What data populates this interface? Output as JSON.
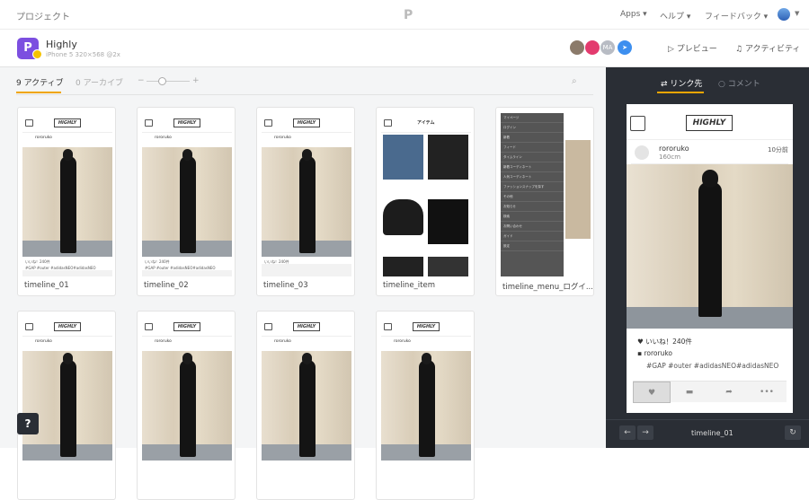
{
  "topbar": {
    "crumb": "プロジェクト",
    "logo": "P",
    "menus": [
      "Apps ▾",
      "ヘルプ ▾",
      "フィードバック ▾"
    ]
  },
  "project": {
    "icon_letter": "P",
    "name": "Highly",
    "device": "iPhone 5  320×568 @2x",
    "avatar_text": "MA",
    "preview_label": "プレビュー",
    "activity_label": "アクティビティ"
  },
  "tabs": {
    "active_label": "9 アクティブ",
    "archive_label": "0 アーカイブ",
    "zoom_minus": "−",
    "zoom_plus": "+",
    "zoom_level": 0.35
  },
  "screens": [
    {
      "label": "timeline_01"
    },
    {
      "label": "timeline_02"
    },
    {
      "label": "timeline_03"
    },
    {
      "label": "timeline_item"
    },
    {
      "label": "timeline_menu_ログイ..."
    },
    {
      "label": ""
    },
    {
      "label": ""
    },
    {
      "label": ""
    },
    {
      "label": ""
    }
  ],
  "mini": {
    "logo": "HIGHLY",
    "user": "rororuko",
    "height": "160cm",
    "time": "10分前",
    "likes": "いいね！240件",
    "tags": "#GAP #outer #adidasNEO#adidasNEO",
    "item_title": "アイテム",
    "menu_items": [
      "マイページ",
      "ログイン",
      "新着",
      "フィード",
      "タイムライン",
      "新着コーディネート",
      "人気コーディネート",
      "ファッションスナップを探す",
      "その他",
      "お知らせ",
      "検索",
      "お問い合わせ",
      "ガイド",
      "設定"
    ]
  },
  "right": {
    "tab_link": "リンク先",
    "tab_comment": "コメント",
    "phone": {
      "logo": "HIGHLY",
      "user": "rororuko",
      "height": "160cm",
      "time": "10分前",
      "likes": "いいね！240件",
      "owner": "rororuko",
      "tags": "#GAP #outer #adidasNEO#adidasNEO",
      "more": "•••"
    },
    "footer_name": "timeline_01"
  },
  "help_label": "?"
}
